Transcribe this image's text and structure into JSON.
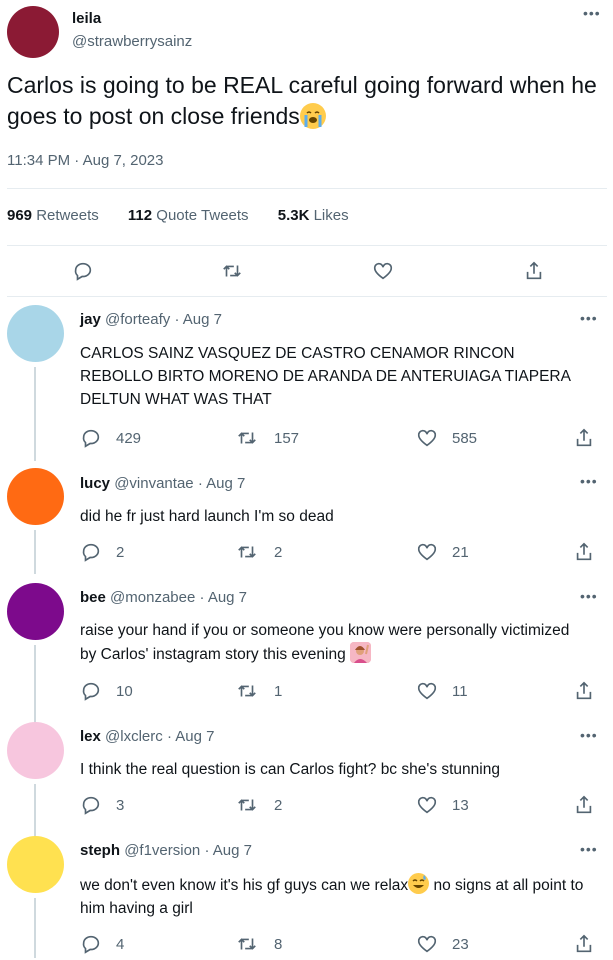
{
  "main_tweet": {
    "name": "leila",
    "handle": "@strawberrysainz",
    "text": "Carlos is going to be REAL careful going forward when he goes to post on close friends",
    "emoji": "loudly-crying-face",
    "time": "11:34 PM · Aug 7, 2023",
    "stats": {
      "retweets_count": "969",
      "retweets_label": "Retweets",
      "quotes_count": "112",
      "quotes_label": "Quote Tweets",
      "likes_count": "5.3K",
      "likes_label": "Likes"
    },
    "avatar_color": "#8b1a34"
  },
  "replies": [
    {
      "name": "jay",
      "handle": "@forteafy",
      "date": "· Aug 7",
      "text": "CARLOS SAINZ VASQUEZ DE CASTRO CENAMOR RINCON REBOLLO BIRTO MORENO DE ARANDA DE ANTERUIAGA TIAPERA DELTUN WHAT WAS THAT",
      "replies": "429",
      "retweets": "157",
      "likes": "585",
      "avatar_color": "#a9d6e8"
    },
    {
      "name": "lucy",
      "handle": "@vinvantae",
      "date": "· Aug 7",
      "text": "did he fr just hard launch I'm so dead",
      "replies": "2",
      "retweets": "2",
      "likes": "21",
      "avatar_color": "#ff6a13"
    },
    {
      "name": "bee",
      "handle": "@monzabee",
      "date": "· Aug 7",
      "text": "raise your hand if you or someone you know were personally victimized by Carlos' instagram story this evening",
      "emoji": "person-raising-hand",
      "replies": "10",
      "retweets": "1",
      "likes": "11",
      "avatar_color": "#7d0a8c"
    },
    {
      "name": "lex",
      "handle": "@lxclerc",
      "date": "· Aug 7",
      "text": "I think the real question is can Carlos fight? bc she's stunning",
      "replies": "3",
      "retweets": "2",
      "likes": "13",
      "avatar_color": "#f7c6de"
    },
    {
      "name": "steph",
      "handle": "@f1version",
      "date": "· Aug 7",
      "text_before": "we don't even know it's his gf guys can we relax",
      "emoji": "grinning-face-with-sweat",
      "text_after": " no signs at all point to him having a girl",
      "replies": "4",
      "retweets": "8",
      "likes": "23",
      "avatar_color": "#ffe150"
    }
  ],
  "colors": {
    "text": "#0f1419",
    "muted": "#536471",
    "divider": "#e6ecf0",
    "thread": "#cfd9de"
  }
}
